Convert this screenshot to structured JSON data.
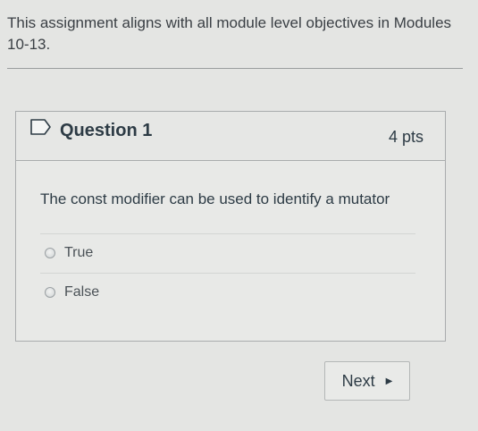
{
  "intro": {
    "text": "This assignment aligns with all module level objectives in Modules 10-13."
  },
  "question": {
    "title": "Question 1",
    "points": "4 pts",
    "text": "The const modifier can be used to identify a mutator",
    "answers": [
      {
        "label": "True",
        "selected": false
      },
      {
        "label": "False",
        "selected": false
      }
    ],
    "bookmark_icon": "bookmark-flag-icon"
  },
  "navigation": {
    "next_label": "Next",
    "next_icon": "caret-right-icon"
  }
}
